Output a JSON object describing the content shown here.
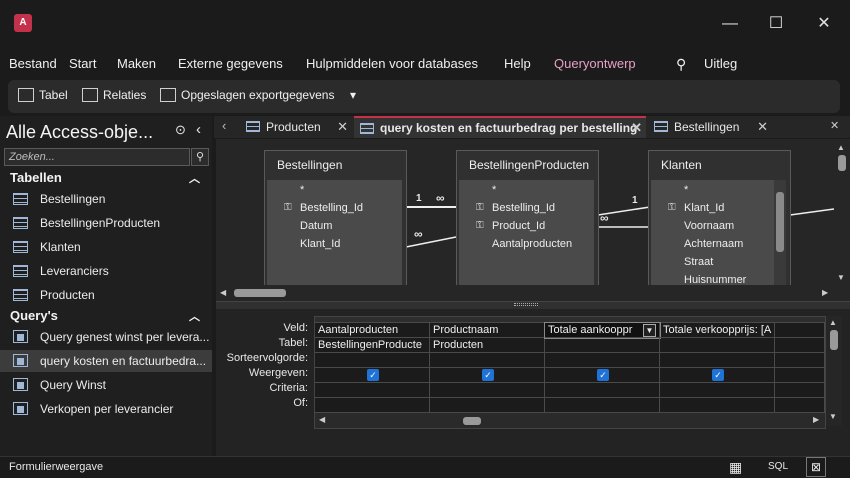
{
  "window": {
    "app_icon": "A",
    "controls": [
      "—",
      "☐",
      "✕"
    ]
  },
  "menu": [
    "Bestand",
    "Start",
    "Maken",
    "Externe gegevens",
    "Hulpmiddelen voor databases",
    "Help",
    "Queryontwerp"
  ],
  "search_label": "Uitleg",
  "ribbon": {
    "tabel": "Tabel",
    "relaties": "Relaties",
    "export": "Opgeslagen exportgegevens",
    "more": "▾"
  },
  "nav": {
    "title": "Alle Access-obje...",
    "search_placeholder": "Zoeken...",
    "tables_header": "Tabellen",
    "tables": [
      "Bestellingen",
      "BestellingenProducten",
      "Klanten",
      "Leveranciers",
      "Producten"
    ],
    "queries_header": "Query's",
    "queries": [
      "Query genest winst per levera...",
      "query kosten en factuurbedra...",
      "Query Winst",
      "Verkopen per leverancier"
    ],
    "selected_query_index": 1
  },
  "tabs": [
    {
      "label": "Producten"
    },
    {
      "label": "query kosten en factuurbedrag per bestelling"
    },
    {
      "label": "Bestellingen"
    }
  ],
  "design": {
    "tables": [
      {
        "name": "Bestellingen",
        "fields": [
          {
            "name": "*",
            "key": false
          },
          {
            "name": "Bestelling_Id",
            "key": true
          },
          {
            "name": "Datum",
            "key": false
          },
          {
            "name": "Klant_Id",
            "key": false
          }
        ]
      },
      {
        "name": "BestellingenProducten",
        "fields": [
          {
            "name": "*",
            "key": false
          },
          {
            "name": "Bestelling_Id",
            "key": true
          },
          {
            "name": "Product_Id",
            "key": true
          },
          {
            "name": "Aantalproducten",
            "key": false
          }
        ]
      },
      {
        "name": "Klanten",
        "fields": [
          {
            "name": "*",
            "key": false
          },
          {
            "name": "Klant_Id",
            "key": true
          },
          {
            "name": "Voornaam",
            "key": false
          },
          {
            "name": "Achternaam",
            "key": false
          },
          {
            "name": "Straat",
            "key": false
          },
          {
            "name": "Huisnummer",
            "key": false
          }
        ]
      }
    ],
    "join_labels": [
      "1",
      "∞",
      "∞",
      "∞",
      "1"
    ]
  },
  "grid": {
    "row_labels": [
      "Veld:",
      "Tabel:",
      "Sorteervolgorde:",
      "Weergeven:",
      "Criteria:",
      "Of:"
    ],
    "columns": [
      {
        "veld": "Aantalproducten",
        "tabel": "BestellingenProducte",
        "weergeven": true
      },
      {
        "veld": "Productnaam",
        "tabel": "Producten",
        "weergeven": true
      },
      {
        "veld": "Totale aankooppr",
        "tabel": "",
        "weergeven": true
      },
      {
        "veld": "Totale verkoopprijs: [A",
        "tabel": "",
        "weergeven": true
      }
    ]
  },
  "status": {
    "left": "Formulierweergave",
    "sql": "SQL"
  }
}
